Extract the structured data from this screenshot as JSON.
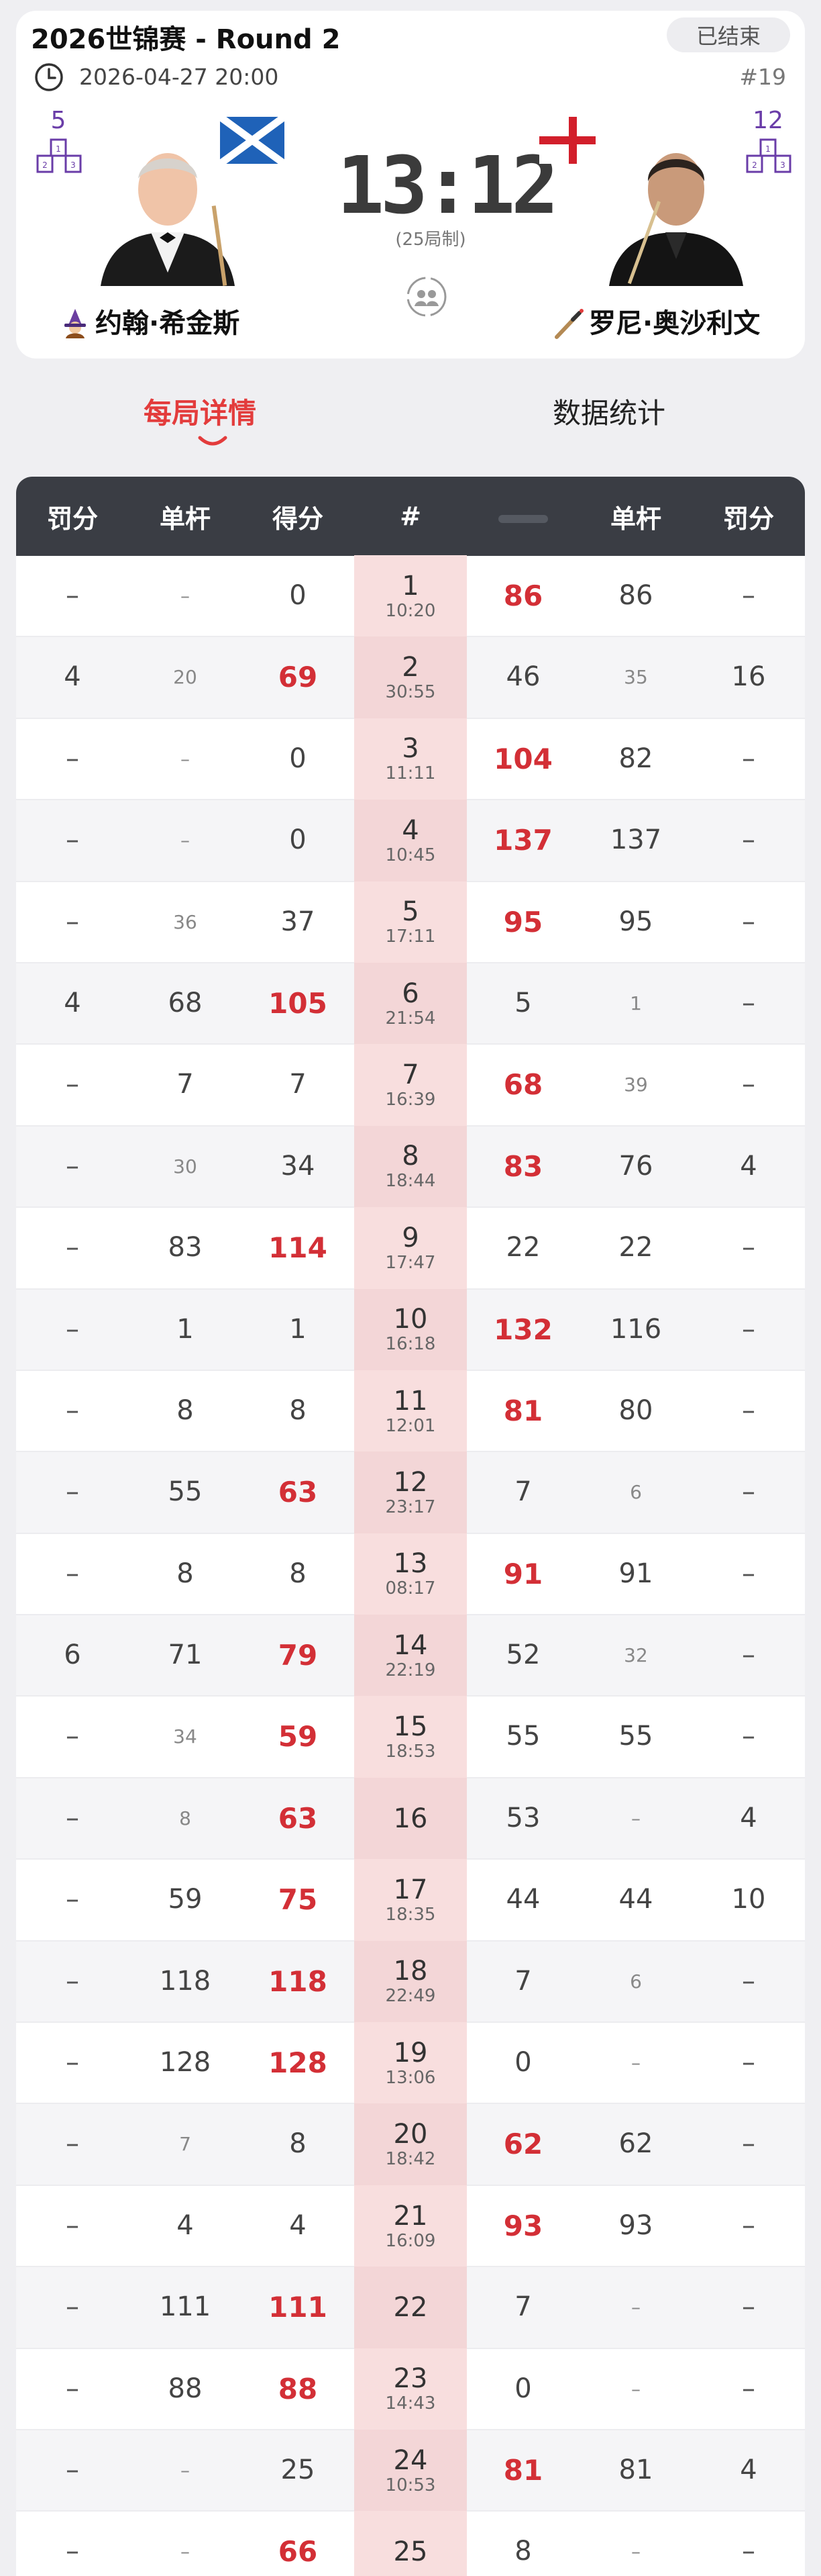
{
  "header": {
    "title": "2026世锦赛 - Round 2",
    "status": "已结束",
    "datetime": "2026-04-27 20:00",
    "match_no": "#19"
  },
  "player_left": {
    "rank": "5",
    "name": "约翰·希金斯",
    "flag": "scotland"
  },
  "player_right": {
    "rank": "12",
    "name": "罗尼·奥沙利文",
    "flag": "england"
  },
  "score": {
    "display": "13:12",
    "format": "(25局制)"
  },
  "tabs": [
    {
      "label": "每局详情",
      "active": true
    },
    {
      "label": "数据统计",
      "active": false
    }
  ],
  "table": {
    "headers": [
      "罚分",
      "单杆",
      "得分",
      "#",
      "",
      "单杆",
      "罚分"
    ],
    "rows": [
      {
        "lp": "–",
        "lb": "–",
        "ls": "0",
        "f": "1",
        "t": "10:20",
        "rs": "86",
        "rb": "86",
        "rp": "–",
        "w": "r"
      },
      {
        "lp": "4",
        "lb": "20",
        "ls": "69",
        "f": "2",
        "t": "30:55",
        "rs": "46",
        "rb": "35",
        "rp": "16",
        "w": "l"
      },
      {
        "lp": "–",
        "lb": "–",
        "ls": "0",
        "f": "3",
        "t": "11:11",
        "rs": "104",
        "rb": "82",
        "rp": "–",
        "w": "r"
      },
      {
        "lp": "–",
        "lb": "–",
        "ls": "0",
        "f": "4",
        "t": "10:45",
        "rs": "137",
        "rb": "137",
        "rp": "–",
        "w": "r"
      },
      {
        "lp": "–",
        "lb": "36",
        "ls": "37",
        "f": "5",
        "t": "17:11",
        "rs": "95",
        "rb": "95",
        "rp": "–",
        "w": "r"
      },
      {
        "lp": "4",
        "lb": "68",
        "ls": "105",
        "f": "6",
        "t": "21:54",
        "rs": "5",
        "rb": "1",
        "rp": "–",
        "w": "l"
      },
      {
        "lp": "–",
        "lb": "7",
        "ls": "7",
        "f": "7",
        "t": "16:39",
        "rs": "68",
        "rb": "39",
        "rp": "–",
        "w": "r"
      },
      {
        "lp": "–",
        "lb": "30",
        "ls": "34",
        "f": "8",
        "t": "18:44",
        "rs": "83",
        "rb": "76",
        "rp": "4",
        "w": "r"
      },
      {
        "lp": "–",
        "lb": "83",
        "ls": "114",
        "f": "9",
        "t": "17:47",
        "rs": "22",
        "rb": "22",
        "rp": "–",
        "w": "l"
      },
      {
        "lp": "–",
        "lb": "1",
        "ls": "1",
        "f": "10",
        "t": "16:18",
        "rs": "132",
        "rb": "116",
        "rp": "–",
        "w": "r"
      },
      {
        "lp": "–",
        "lb": "8",
        "ls": "8",
        "f": "11",
        "t": "12:01",
        "rs": "81",
        "rb": "80",
        "rp": "–",
        "w": "r"
      },
      {
        "lp": "–",
        "lb": "55",
        "ls": "63",
        "f": "12",
        "t": "23:17",
        "rs": "7",
        "rb": "6",
        "rp": "–",
        "w": "l"
      },
      {
        "lp": "–",
        "lb": "8",
        "ls": "8",
        "f": "13",
        "t": "08:17",
        "rs": "91",
        "rb": "91",
        "rp": "–",
        "w": "r"
      },
      {
        "lp": "6",
        "lb": "71",
        "ls": "79",
        "f": "14",
        "t": "22:19",
        "rs": "52",
        "rb": "32",
        "rp": "–",
        "w": "l"
      },
      {
        "lp": "–",
        "lb": "34",
        "ls": "59",
        "f": "15",
        "t": "18:53",
        "rs": "55",
        "rb": "55",
        "rp": "–",
        "w": "l"
      },
      {
        "lp": "–",
        "lb": "8",
        "ls": "63",
        "f": "16",
        "t": "",
        "rs": "53",
        "rb": "–",
        "rp": "4",
        "w": "l"
      },
      {
        "lp": "–",
        "lb": "59",
        "ls": "75",
        "f": "17",
        "t": "18:35",
        "rs": "44",
        "rb": "44",
        "rp": "10",
        "w": "l"
      },
      {
        "lp": "–",
        "lb": "118",
        "ls": "118",
        "f": "18",
        "t": "22:49",
        "rs": "7",
        "rb": "6",
        "rp": "–",
        "w": "l"
      },
      {
        "lp": "–",
        "lb": "128",
        "ls": "128",
        "f": "19",
        "t": "13:06",
        "rs": "0",
        "rb": "–",
        "rp": "–",
        "w": "l"
      },
      {
        "lp": "–",
        "lb": "7",
        "ls": "8",
        "f": "20",
        "t": "18:42",
        "rs": "62",
        "rb": "62",
        "rp": "–",
        "w": "r"
      },
      {
        "lp": "–",
        "lb": "4",
        "ls": "4",
        "f": "21",
        "t": "16:09",
        "rs": "93",
        "rb": "93",
        "rp": "–",
        "w": "r"
      },
      {
        "lp": "–",
        "lb": "111",
        "ls": "111",
        "f": "22",
        "t": "",
        "rs": "7",
        "rb": "–",
        "rp": "–",
        "w": "l"
      },
      {
        "lp": "–",
        "lb": "88",
        "ls": "88",
        "f": "23",
        "t": "14:43",
        "rs": "0",
        "rb": "–",
        "rp": "–",
        "w": "l"
      },
      {
        "lp": "–",
        "lb": "–",
        "ls": "25",
        "f": "24",
        "t": "10:53",
        "rs": "81",
        "rb": "81",
        "rp": "4",
        "w": "r"
      },
      {
        "lp": "–",
        "lb": "–",
        "ls": "66",
        "f": "25",
        "t": "",
        "rs": "8",
        "rb": "–",
        "rp": "–",
        "w": "l"
      }
    ]
  },
  "colors": {
    "accent": "#e33c3c",
    "winner_score": "#d32f36",
    "table_header_bg": "#3a3d44",
    "frame_column_bg": "#f8dede",
    "rank_purple": "#6a3da8"
  }
}
